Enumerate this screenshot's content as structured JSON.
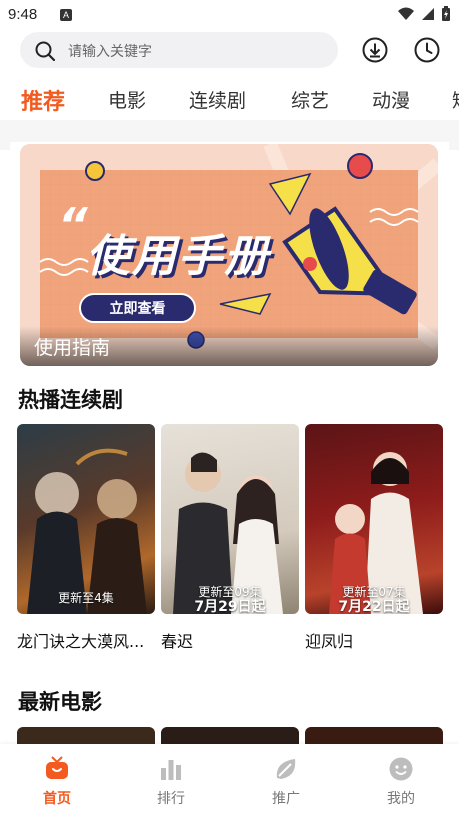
{
  "status_bar": {
    "time": "9:48",
    "notification_badge": "A"
  },
  "search": {
    "placeholder": "请输入关键字"
  },
  "header_icons": [
    "download-icon",
    "history-clock-icon"
  ],
  "tabs": [
    {
      "label": "推荐",
      "active": true
    },
    {
      "label": "电影",
      "active": false
    },
    {
      "label": "连续剧",
      "active": false
    },
    {
      "label": "综艺",
      "active": false
    },
    {
      "label": "动漫",
      "active": false
    },
    {
      "label": "短",
      "active": false
    }
  ],
  "banner": {
    "headline": "使用手册",
    "quote_mark": "“",
    "cta": "立即查看",
    "caption": "使用指南"
  },
  "hot_series": {
    "title": "热播连续剧",
    "items": [
      {
        "title": "龙门诀之大漠风...",
        "badge": "更新至4集",
        "date": ""
      },
      {
        "title": "春迟",
        "badge": "更新至09集",
        "date": "7月29日起"
      },
      {
        "title": "迎凤归",
        "badge": "更新至07集",
        "date": "7月22日起"
      }
    ]
  },
  "new_movies": {
    "title": "最新电影"
  },
  "bottom_nav": [
    {
      "label": "首页",
      "icon": "home-tv-icon",
      "active": true
    },
    {
      "label": "排行",
      "icon": "bar-chart-icon",
      "active": false
    },
    {
      "label": "推广",
      "icon": "share-leaf-icon",
      "active": false
    },
    {
      "label": "我的",
      "icon": "profile-face-icon",
      "active": false
    }
  ],
  "colors": {
    "accent": "#f35a1f",
    "banner_bg": "#f8d9c9",
    "banner_panel": "#f1a47c"
  }
}
